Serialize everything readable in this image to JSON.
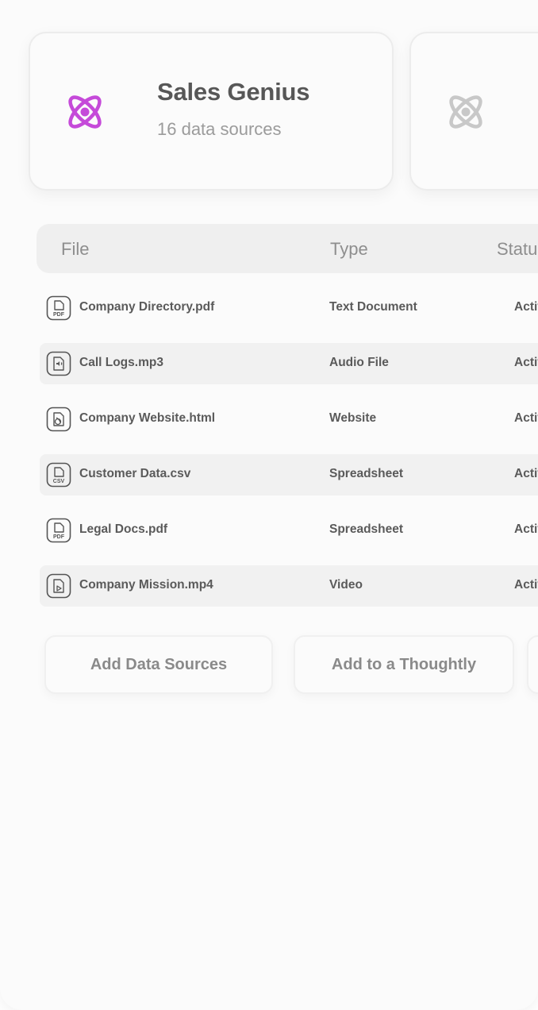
{
  "colors": {
    "accent": "#c54ad9",
    "muted_icon": "#c8c8c8"
  },
  "cards": [
    {
      "icon": "atom-icon",
      "title": "Sales Genius",
      "subtitle": "16 data sources"
    },
    {
      "icon": "atom-icon",
      "title": "",
      "subtitle": ""
    }
  ],
  "table": {
    "headers": {
      "file": "File",
      "type": "Type",
      "status": "Status"
    },
    "rows": [
      {
        "icon": "pdf-file-icon",
        "badge": "PDF",
        "name": "Company Directory.pdf",
        "type": "Text Document",
        "status": "Active"
      },
      {
        "icon": "audio-file-icon",
        "badge": "",
        "name": "Call Logs.mp3",
        "type": "Audio File",
        "status": "Active"
      },
      {
        "icon": "web-file-icon",
        "badge": "",
        "name": "Company Website.html",
        "type": "Website",
        "status": "Active"
      },
      {
        "icon": "csv-file-icon",
        "badge": "CSV",
        "name": "Customer Data.csv",
        "type": "Spreadsheet",
        "status": "Active"
      },
      {
        "icon": "pdf-file-icon",
        "badge": "PDF",
        "name": "Legal Docs.pdf",
        "type": "Spreadsheet",
        "status": "Active"
      },
      {
        "icon": "video-file-icon",
        "badge": "",
        "name": "Company Mission.mp4",
        "type": "Video",
        "status": "Active"
      }
    ]
  },
  "actions": {
    "add_data_sources": "Add Data Sources",
    "add_to_thoughtly": "Add to a Thoughtly",
    "third": ""
  }
}
